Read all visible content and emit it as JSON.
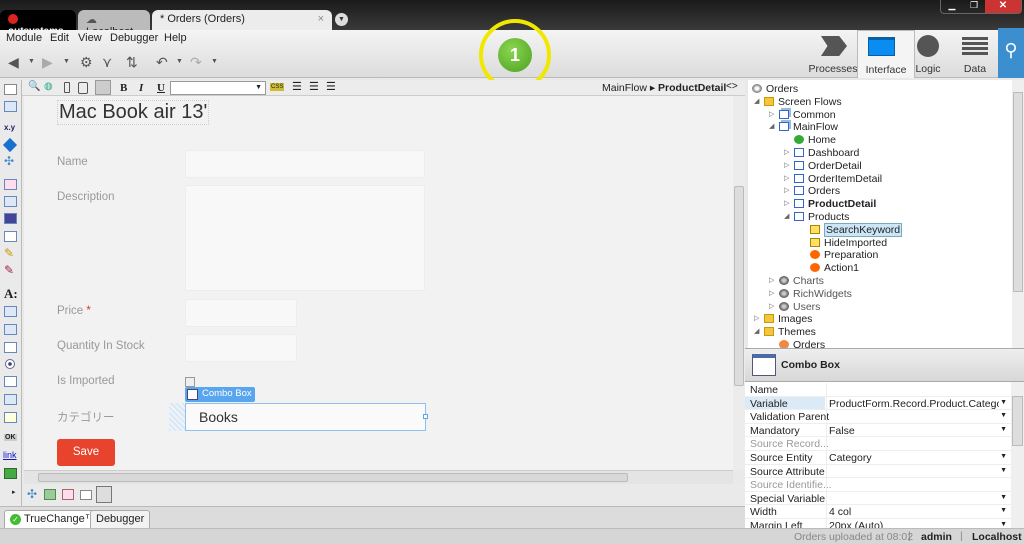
{
  "window": {
    "brand": "outsystems",
    "tabs": [
      {
        "label": "Localhost"
      },
      {
        "label": "* Orders (Orders)",
        "active": true
      }
    ],
    "close_tab": "×"
  },
  "menu": [
    {
      "label": "Module"
    },
    {
      "label": "Edit"
    },
    {
      "label": "View"
    },
    {
      "label": "Debugger"
    },
    {
      "label": "Help"
    }
  ],
  "annotation": {
    "label": "1",
    "ring_color": "#f0e800",
    "fill_color": "#5cb82e"
  },
  "right_tabs": [
    {
      "label": "Processes"
    },
    {
      "label": "Interface",
      "active": true
    },
    {
      "label": "Logic"
    },
    {
      "label": "Data"
    }
  ],
  "editor_toolbar": {
    "bold": "B",
    "italic": "I",
    "underline": "U",
    "style_value": "",
    "css": "CSS",
    "breadcrumb": [
      "MainFlow",
      "ProductDetail"
    ],
    "splitter": "<>"
  },
  "canvas": {
    "title": "Mac Book air 13'",
    "fields": [
      {
        "label": "Name"
      },
      {
        "label": "Description"
      },
      {
        "label": "Price",
        "required": "*"
      },
      {
        "label": "Quantity In Stock"
      },
      {
        "label": "Is Imported"
      },
      {
        "label": "カテゴリー"
      }
    ],
    "combo_tag": "Combo Box",
    "combo_value": "Books",
    "save_label": "Save",
    "save_color": "#e8432d"
  },
  "bottom_tabs": [
    {
      "label": "TrueChange™"
    },
    {
      "label": "Debugger"
    }
  ],
  "tree": [
    {
      "label": "Orders",
      "icon": "module"
    },
    {
      "label": "Screen Flows",
      "icon": "folder"
    },
    {
      "label": "Common",
      "icon": "flow"
    },
    {
      "label": "MainFlow",
      "icon": "flow"
    },
    {
      "label": "Home",
      "icon": "home-screen"
    },
    {
      "label": "Dashboard",
      "icon": "screen"
    },
    {
      "label": "OrderDetail",
      "icon": "screen"
    },
    {
      "label": "OrderItemDetail",
      "icon": "screen"
    },
    {
      "label": "Orders",
      "icon": "screen"
    },
    {
      "label": "ProductDetail",
      "icon": "screen",
      "bold": true
    },
    {
      "label": "Products",
      "icon": "screen"
    },
    {
      "label": "SearchKeyword",
      "icon": "variable",
      "selected": true
    },
    {
      "label": "HideImported",
      "icon": "variable"
    },
    {
      "label": "Preparation",
      "icon": "action"
    },
    {
      "label": "Action1",
      "icon": "action"
    },
    {
      "label": "Charts",
      "icon": "reference"
    },
    {
      "label": "RichWidgets",
      "icon": "reference"
    },
    {
      "label": "Users",
      "icon": "reference"
    },
    {
      "label": "Images",
      "icon": "folder"
    },
    {
      "label": "Themes",
      "icon": "folder"
    },
    {
      "label": "Orders",
      "icon": "theme"
    }
  ],
  "properties": {
    "title": "Combo Box",
    "rows": [
      {
        "name": "Name",
        "value": ""
      },
      {
        "name": "Variable",
        "value": "ProductForm.Record.Product.Category",
        "dropdown": true
      },
      {
        "name": "Validation Parent",
        "value": "",
        "dropdown": true
      },
      {
        "name": "Mandatory",
        "value": "False",
        "dropdown": true
      },
      {
        "name": "Source Record...",
        "value": "",
        "disabled": true
      },
      {
        "name": "Source Entity",
        "value": "Category",
        "dropdown": true
      },
      {
        "name": "Source Attribute",
        "value": "",
        "dropdown": true
      },
      {
        "name": "Source Identifie...",
        "value": "",
        "disabled": true
      },
      {
        "name": "Special Variable",
        "value": "",
        "dropdown": true
      },
      {
        "name": "Width",
        "value": "4 col",
        "dropdown": true
      },
      {
        "name": "Margin Left",
        "value": "20px (Auto)",
        "dropdown": true
      }
    ]
  },
  "status": {
    "message": "Orders uploaded at 08:02",
    "user": "admin",
    "server": "Localhost"
  }
}
